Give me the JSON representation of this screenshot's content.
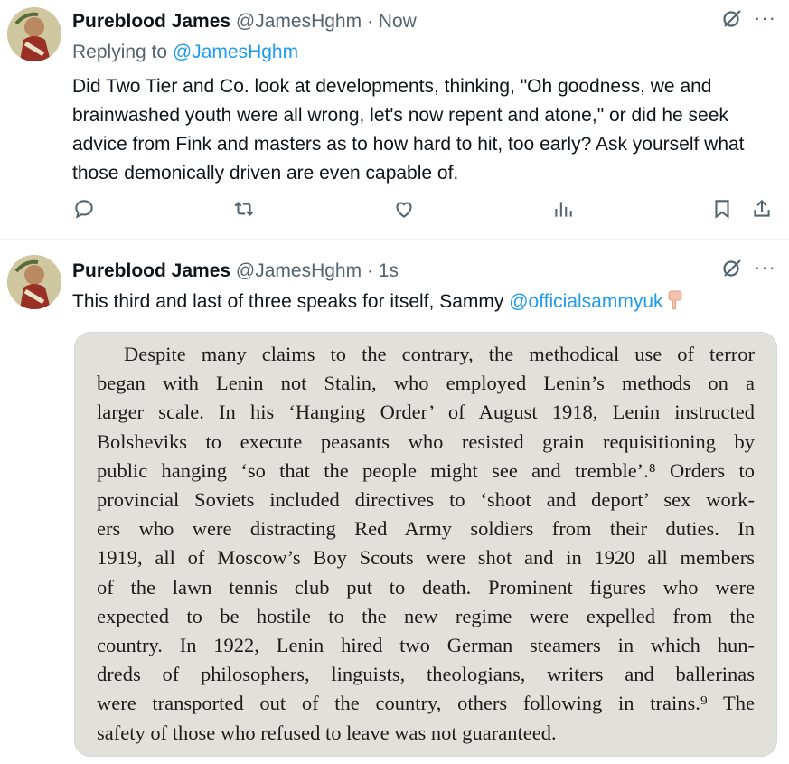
{
  "tweet1": {
    "name": "Pureblood James",
    "handle": "@JamesHghm",
    "dot": "·",
    "time": "Now",
    "replying_prefix": "Replying to ",
    "replying_handle": "@JamesHghm",
    "text": "Did Two Tier and Co. look at developments, thinking, \"Oh goodness, we and brainwashed youth were all wrong, let's now repent and atone,\" or did he seek advice from Fink and masters as to how hard to hit, too early? Ask yourself what those demonically driven are even capable of.",
    "more": "···"
  },
  "tweet2": {
    "name": "Pureblood James",
    "handle": "@JamesHghm",
    "dot": "·",
    "time": "1s",
    "text": "This third and last of three speaks for itself, Sammy ",
    "mention": "@officialsammyuk",
    "more": "···"
  },
  "book_page": {
    "lines": [
      "Despite many claims to the contrary, the methodical use of terror",
      "began with Lenin not Stalin, who employed Lenin’s methods on a",
      "larger scale. In his ‘Hanging Order’ of August 1918, Lenin instructed",
      "Bolsheviks to execute peasants who resisted grain requisitioning by",
      "public hanging ‘so that the people might see and tremble’.⁸ Orders to",
      "provincial Soviets included directives to ‘shoot and deport’ sex work-",
      "ers who were distracting Red Army soldiers from their duties. In",
      "1919, all of Moscow’s Boy Scouts were shot and in 1920 all members",
      "of the lawn tennis club put to death. Prominent figures who were",
      "expected to be hostile to the new regime were expelled from the",
      "country. In 1922, Lenin hired two German steamers in which hun-",
      "dreds of philosophers, linguists, theologians, writers and ballerinas",
      "were transported out of the country, others following in trains.⁹ The",
      "safety of those who refused to leave was not guaranteed."
    ]
  },
  "icons": {
    "reply": "reply-icon",
    "retweet": "retweet-icon",
    "like": "like-icon",
    "views": "views-icon",
    "bookmark": "bookmark-icon",
    "share": "share-icon",
    "grok": "grok-icon",
    "emoji": "pointing-down-emoji"
  },
  "colors": {
    "text": "#0f1419",
    "secondary": "#536471",
    "link": "#1d9bf0",
    "page": "#e2e0da"
  }
}
